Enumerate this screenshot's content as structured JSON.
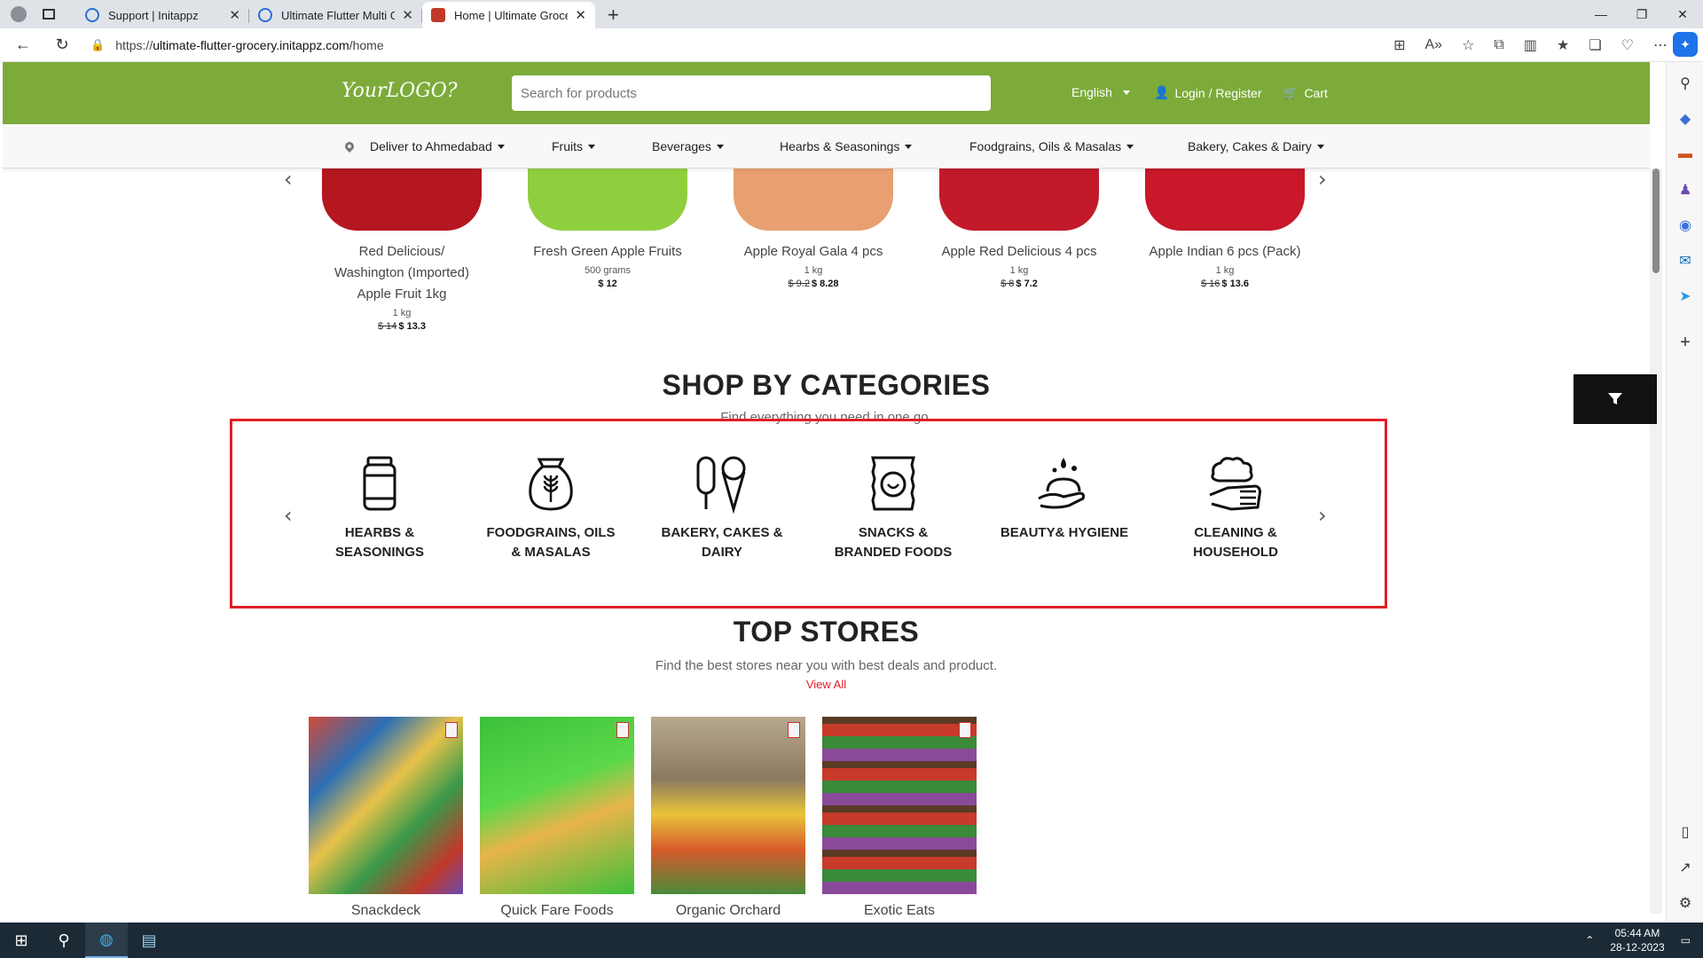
{
  "browser": {
    "tabs": [
      {
        "title": "Support | Initappz",
        "active": false
      },
      {
        "title": "Ultimate Flutter Multi Grocery De",
        "active": false
      },
      {
        "title": "Home | Ultimate Grocery Flutter",
        "active": true
      }
    ],
    "url_prefix": "https://",
    "url_host": "ultimate-flutter-grocery.initappz.com",
    "url_path": "/home"
  },
  "header": {
    "logo": "YourLOGO?",
    "search_placeholder": "Search for products",
    "language": "English",
    "login": "Login / Register",
    "cart": "Cart"
  },
  "nav": {
    "deliver": "Deliver to Ahmedabad",
    "items": [
      "Fruits",
      "Beverages",
      "Hearbs & Seasonings",
      "Foodgrains, Oils & Masalas",
      "Bakery, Cakes & Dairy"
    ]
  },
  "products": [
    {
      "name_lines": [
        "Red Delicious/",
        "Washington (Imported)",
        "Apple Fruit 1kg"
      ],
      "qty": "1 kg",
      "old_price": "$ 14",
      "price": "$ 13.3",
      "color": "#b4171f"
    },
    {
      "name_lines": [
        "Fresh Green Apple Fruits"
      ],
      "qty": "500 grams",
      "old_price": "",
      "price": "$ 12",
      "color": "#8fcf3f"
    },
    {
      "name_lines": [
        "Apple Royal Gala 4 pcs"
      ],
      "qty": "1 kg",
      "old_price": "$ 9.2",
      "price": "$ 8.28",
      "color": "#e8a070"
    },
    {
      "name_lines": [
        "Apple Red Delicious 4 pcs"
      ],
      "qty": "1 kg",
      "old_price": "$ 8",
      "price": "$ 7.2",
      "color": "#c21a2a"
    },
    {
      "name_lines": [
        "Apple Indian 6 pcs (Pack)"
      ],
      "qty": "1 kg",
      "old_price": "$ 16",
      "price": "$ 13.6",
      "color": "#c8182a"
    }
  ],
  "categories_section": {
    "title": "SHOP BY CATEGORIES",
    "subtitle": "Find everything you need in one go.",
    "items": [
      {
        "label_lines": [
          "HEARBS &",
          "SEASONINGS"
        ],
        "icon": "jar-icon"
      },
      {
        "label_lines": [
          "FOODGRAINS, OILS",
          "& MASALAS"
        ],
        "icon": "grain-sack-icon"
      },
      {
        "label_lines": [
          "BAKERY, CAKES &",
          "DAIRY"
        ],
        "icon": "ice-cream-icon"
      },
      {
        "label_lines": [
          "SNACKS &",
          "BRANDED FOODS"
        ],
        "icon": "snack-pack-icon"
      },
      {
        "label_lines": [
          "BEAUTY& HYGIENE"
        ],
        "icon": "hand-wash-icon"
      },
      {
        "label_lines": [
          "CLEANING &",
          "HOUSEHOLD"
        ],
        "icon": "cleaning-hand-icon"
      }
    ]
  },
  "stores_section": {
    "title": "TOP STORES",
    "subtitle": "Find the best stores near you with best deals and product.",
    "view_all": "View All",
    "stores": [
      {
        "name": "Snackdeck"
      },
      {
        "name": "Quick Fare Foods"
      },
      {
        "name": "Organic Orchard"
      },
      {
        "name": "Exotic Eats"
      }
    ]
  },
  "taskbar": {
    "time": "05:44 AM",
    "date": "28-12-2023"
  },
  "colors": {
    "brand_green": "#7cab3a",
    "highlight_red": "#e01f26",
    "view_all_red": "#e01f26"
  }
}
